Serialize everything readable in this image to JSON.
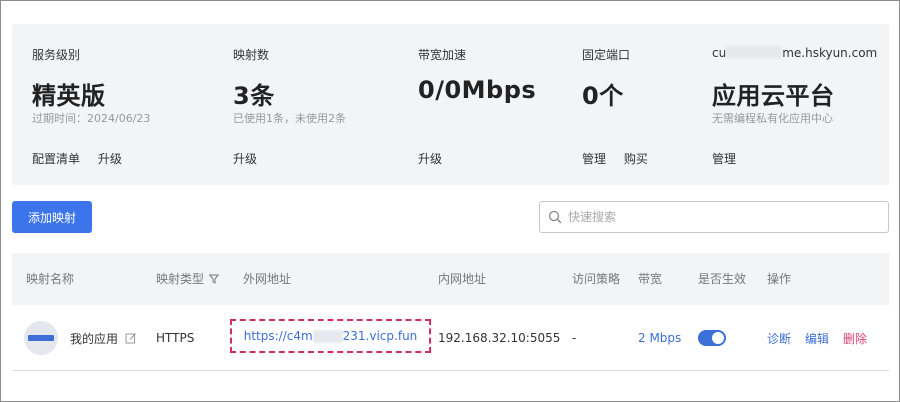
{
  "summary": {
    "service": {
      "label": "服务级别",
      "value": "精英版",
      "sub": "过期时间：2024/06/23",
      "actions": [
        "配置清单",
        "升级"
      ]
    },
    "mapping": {
      "label": "映射数",
      "value": "3条",
      "sub": "已使用1条，未使用2条",
      "actions": [
        "升级"
      ]
    },
    "bandwidth": {
      "label": "带宽加速",
      "value": "0/0Mbps",
      "actions": [
        "升级"
      ]
    },
    "port": {
      "label": "固定端口",
      "value": "0个",
      "actions": [
        "管理",
        "购买"
      ]
    },
    "cloud": {
      "label_prefix": "cu",
      "label_suffix": "me.hskyun.com",
      "value": "应用云平台",
      "sub": "无需编程私有化应用中心",
      "actions": [
        "管理"
      ]
    }
  },
  "toolbar": {
    "add_label": "添加映射",
    "search_placeholder": "快速搜索"
  },
  "table": {
    "headers": [
      "映射名称",
      "映射类型",
      "外网地址",
      "内网地址",
      "访问策略",
      "带宽",
      "是否生效",
      "操作"
    ],
    "row": {
      "name": "我的应用",
      "type": "HTTPS",
      "external_prefix": "https://c4m",
      "external_suffix": "231.vicp.fun",
      "internal": "192.168.32.10:5055",
      "policy": "-",
      "bandwidth": "2 Mbps",
      "enabled": true,
      "ops": [
        "诊断",
        "编辑",
        "删除"
      ]
    }
  },
  "colors": {
    "primary": "#3c74ec",
    "link": "#3c6fd8",
    "danger": "#d9436e",
    "highlight": "#d1315d",
    "panel": "#f3f4f6"
  }
}
